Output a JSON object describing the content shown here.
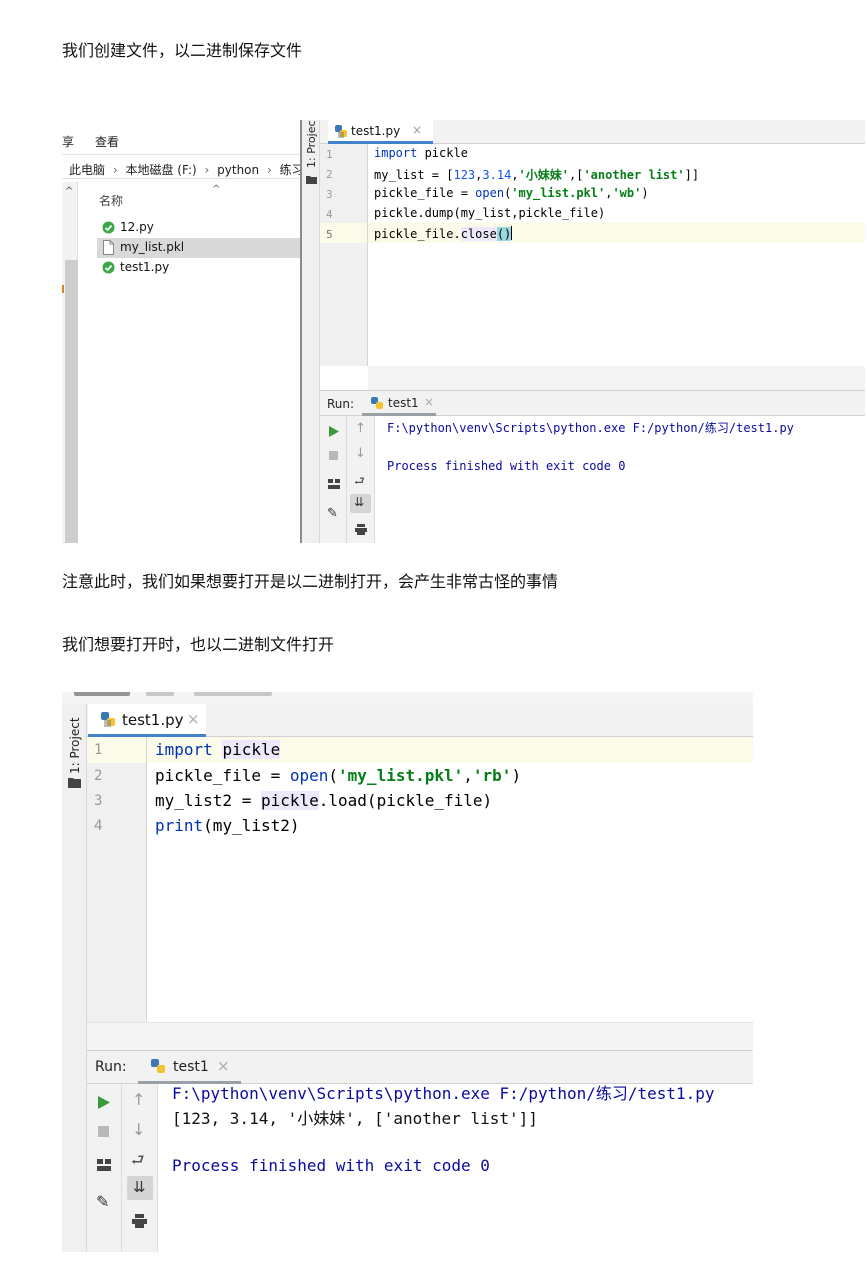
{
  "paragraphs": {
    "intro": "我们创建文件，以二进制保存文件",
    "note": "注意此时，我们如果想要打开是以二进制打开，会产生非常古怪的事情",
    "open": "我们想要打开时，也以二进制文件打开"
  },
  "shot1": {
    "explorer": {
      "ribbon_left": "享",
      "ribbon_view": "查看",
      "breadcrumb": [
        "此电脑",
        "本地磁盘 (F:)",
        "python",
        "练习"
      ],
      "column_header": "名称",
      "files": [
        "12.py",
        "my_list.pkl",
        "test1.py"
      ]
    },
    "project_label": "1: Project",
    "tab": "test1.py",
    "line_numbers": [
      "1",
      "2",
      "3",
      "4",
      "5"
    ],
    "code": {
      "l1_kw": "import",
      "l1_rest": " pickle",
      "l2_a": "my_list = [",
      "l2_n1": "123",
      "l2_c1": ",",
      "l2_n2": "3.14",
      "l2_c2": ",",
      "l2_s1": "'小妹妹'",
      "l2_c3": ",[",
      "l2_s2": "'another list'",
      "l2_end": "]]",
      "l3_a": "pickle_file = ",
      "l3_kw": "open",
      "l3_b": "(",
      "l3_s1": "'my_list.pkl'",
      "l3_c": ",",
      "l3_s2": "'wb'",
      "l3_end": ")",
      "l4": "pickle.dump(my_list,pickle_file)",
      "l5_a": "pickle_file.",
      "l5_b": "close",
      "l5_c": "()"
    },
    "run_label": "Run:",
    "run_tab": "test1",
    "output": [
      "F:\\python\\venv\\Scripts\\python.exe F:/python/练习/test1.py",
      "Process finished with exit code 0"
    ]
  },
  "shot2": {
    "project_label": "1: Project",
    "tab": "test1.py",
    "line_numbers": [
      "1",
      "2",
      "3",
      "4"
    ],
    "code": {
      "l1_kw": "import",
      "l1_sp": " ",
      "l1_mod": "pickle",
      "l2_a": "pickle_file = ",
      "l2_kw": "open",
      "l2_b": "(",
      "l2_s1": "'my_list.pkl'",
      "l2_c": ",",
      "l2_s2": "'rb'",
      "l2_end": ")",
      "l3_a": "my_list2 = ",
      "l3_mod": "pickle",
      "l3_b": ".load(pickle_file)",
      "l4_kw": "print",
      "l4_b": "(my_list2)"
    },
    "run_label": "Run:",
    "run_tab": "test1",
    "output": [
      "F:\\python\\venv\\Scripts\\python.exe F:/python/练习/test1.py",
      "[123, 3.14, '小妹妹', ['another list']]",
      "Process finished with exit code 0"
    ]
  },
  "colors": {
    "keyword": "#0033b3",
    "string": "#067d17",
    "number": "#1750eb",
    "output_blue": "#0a0aa0",
    "tab_underline": "#4083c9",
    "run_green": "#3a9a3a"
  }
}
